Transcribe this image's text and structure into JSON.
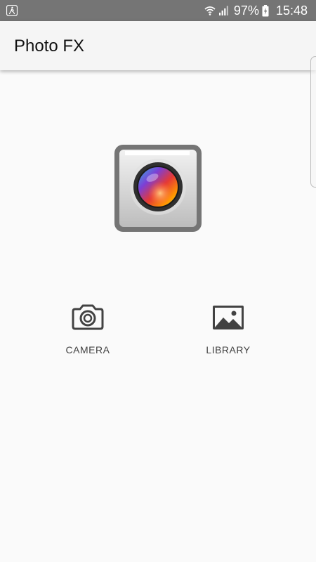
{
  "status_bar": {
    "battery_percent": "97%",
    "time": "15:48",
    "icons": [
      "app-notification-icon",
      "wifi-icon",
      "signal-icon",
      "battery-charging-icon"
    ]
  },
  "app_bar": {
    "title": "Photo FX"
  },
  "logo": {
    "icon": "camera-lens-logo-icon"
  },
  "actions": [
    {
      "label": "CAMERA",
      "icon": "camera-icon"
    },
    {
      "label": "LIBRARY",
      "icon": "image-gallery-icon"
    }
  ],
  "colors": {
    "status_bar": "#757575",
    "app_bar": "#f5f5f5",
    "background": "#fafafa",
    "icon": "#424242"
  }
}
